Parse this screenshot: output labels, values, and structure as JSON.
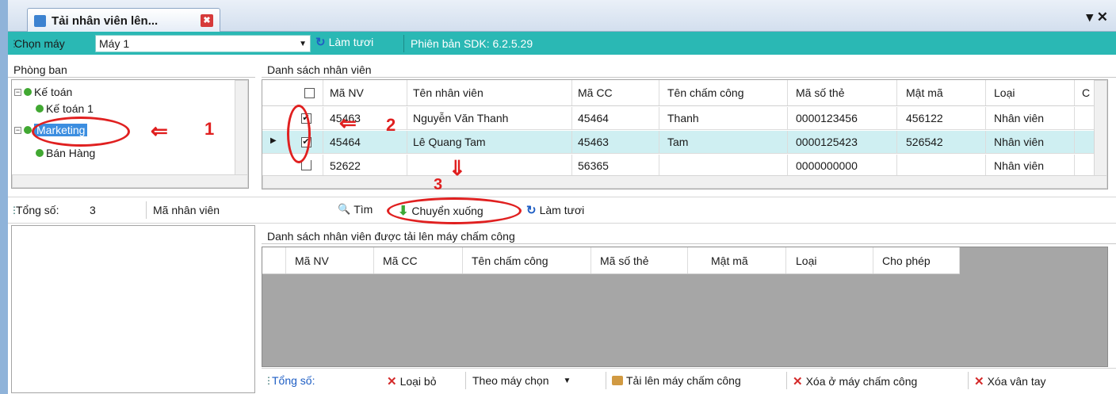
{
  "window": {
    "tab_title": "Tải nhân viên lên...",
    "tab_close": "✖",
    "controls": "▾ ✕"
  },
  "topbar": {
    "machine_label": "Chọn máy",
    "machine_value": "Máy 1",
    "refresh_label": "Làm tươi",
    "sdk_label": "Phiên bản SDK: 6.2.5.29"
  },
  "department": {
    "title": "Phòng ban",
    "tree": [
      "Kế toán",
      "Kế toán 1",
      "Marketing",
      "Bán Hàng"
    ]
  },
  "employees": {
    "title": "Danh sách nhân viên",
    "columns": [
      "Mã NV",
      "Tên nhân viên",
      "Mã CC",
      "Tên chấm công",
      "Mã số thẻ",
      "Mật mã",
      "Loại",
      "C"
    ],
    "rows": [
      {
        "checked": true,
        "cells": [
          "45463",
          "Nguyễn Văn Thanh",
          "45464",
          "Thanh",
          "0000123456",
          "456122",
          "Nhân viên"
        ]
      },
      {
        "checked": true,
        "cells": [
          "45464",
          "Lê Quang Tam",
          "45463",
          "Tam",
          "0000125423",
          "526542",
          "Nhân viên"
        ]
      },
      {
        "checked": false,
        "cells": [
          "52622",
          "",
          "56365",
          "",
          "0000000000",
          "",
          "Nhân viên"
        ]
      }
    ]
  },
  "middle": {
    "total_label": "Tổng số:",
    "total_value": "3",
    "search_field": "Mã nhân viên",
    "find": "Tìm",
    "move_down": "Chuyển xuống",
    "refresh": "Làm tươi"
  },
  "upload": {
    "title": "Danh sách nhân viên được tải lên máy chấm công",
    "columns": [
      "Mã NV",
      "Mã CC",
      "Tên chấm công",
      "Mã số thẻ",
      "Mật mã",
      "Loại",
      "Cho phép"
    ]
  },
  "bottom": {
    "total_label": "Tổng số:",
    "remove": "Loại bỏ",
    "by_machine": "Theo máy chọn",
    "upload_btn": "Tải lên máy chấm công",
    "delete_machine": "Xóa ở máy chấm công",
    "delete_finger": "Xóa vân tay"
  },
  "annotations": {
    "a1": "1",
    "a2": "2",
    "a3": "3"
  },
  "colors": {
    "teal": "#2ab8b4",
    "annotation": "#e02020",
    "selected": "#3c8ee0",
    "row_highlight": "#cfeff2"
  }
}
